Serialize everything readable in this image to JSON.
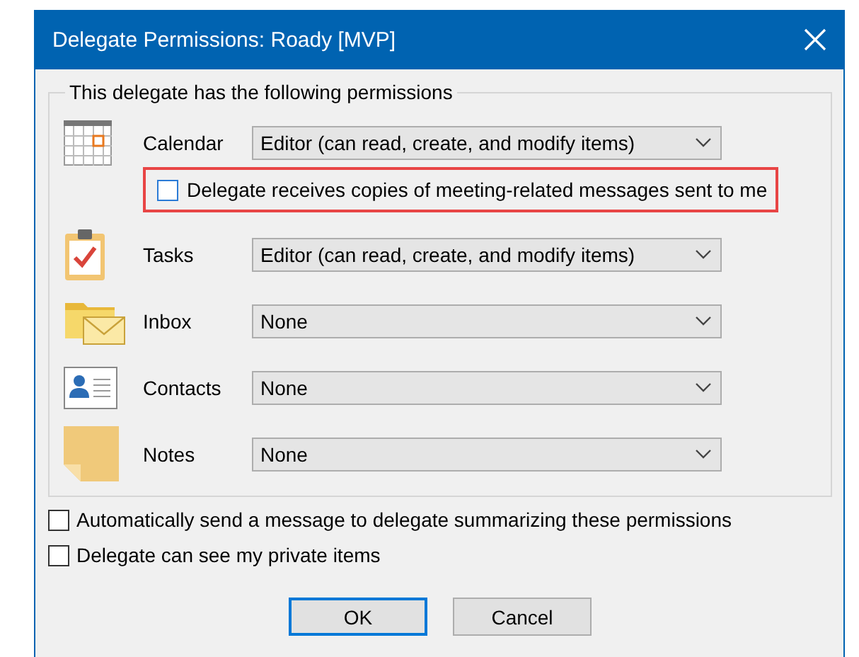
{
  "window": {
    "title": "Delegate Permissions: Roady [MVP]"
  },
  "group": {
    "title": "This delegate has the following permissions",
    "rows": [
      {
        "kind": "calendar",
        "label": "Calendar",
        "value": "Editor (can read, create, and modify items)",
        "option": {
          "label": "Delegate receives copies of meeting-related messages sent to me",
          "checked": false,
          "highlighted": true
        }
      },
      {
        "kind": "tasks",
        "label": "Tasks",
        "value": "Editor (can read, create, and modify items)"
      },
      {
        "kind": "inbox",
        "label": "Inbox",
        "value": "None"
      },
      {
        "kind": "contacts",
        "label": "Contacts",
        "value": "None"
      },
      {
        "kind": "notes",
        "label": "Notes",
        "value": "None"
      }
    ]
  },
  "options": [
    {
      "label": "Automatically send a message to delegate summarizing these permissions",
      "checked": false
    },
    {
      "label": "Delegate can see my private items",
      "checked": false
    }
  ],
  "buttons": [
    {
      "label": "OK",
      "default": true
    },
    {
      "label": "Cancel",
      "default": false
    }
  ]
}
